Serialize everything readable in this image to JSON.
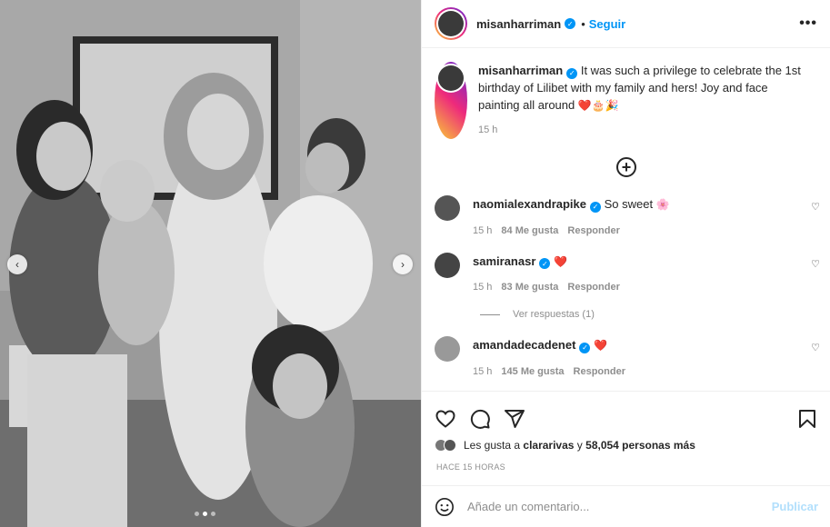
{
  "post": {
    "username": "misanharriman",
    "follow_label": "Seguir",
    "more_label": "•••",
    "caption_text": "It was such a privilege to celebrate the 1st birthday of Lilibet with my family and hers! Joy and face painting all around",
    "caption_emojis": "❤️🎂🎉",
    "caption_time": "15 h"
  },
  "comments": [
    {
      "username": "naomialexandrapike",
      "text": "So sweet",
      "emoji": "🌸",
      "time": "15 h",
      "likes": "84 Me gusta",
      "reply_label": "Responder"
    },
    {
      "username": "samiranasr",
      "text": "",
      "emoji": "❤️",
      "time": "15 h",
      "likes": "83 Me gusta",
      "reply_label": "Responder",
      "view_replies": "Ver respuestas (1)"
    },
    {
      "username": "amandadecadenet",
      "text": "",
      "emoji": "❤️",
      "time": "15 h",
      "likes": "145 Me gusta",
      "reply_label": "Responder"
    }
  ],
  "likes_summary": {
    "prefix": "Les gusta a",
    "user": "clararivas",
    "connector": "y",
    "count": "58,054 personas más"
  },
  "time_ago": "HACE 15 HORAS",
  "add_comment": {
    "placeholder": "Añade un comentario...",
    "publish_label": "Publicar"
  },
  "carousel": {
    "current": 2,
    "total": 3
  },
  "colors": {
    "verified": "#0095f6",
    "link": "#0095f6",
    "publish_disabled": "#b2dffc",
    "heart": "#ed4956"
  },
  "icons": [
    "heart-icon",
    "comment-icon",
    "share-icon",
    "bookmark-icon",
    "emoji-icon",
    "verified-icon",
    "add-circle-icon",
    "chevron-left-icon",
    "chevron-right-icon"
  ]
}
